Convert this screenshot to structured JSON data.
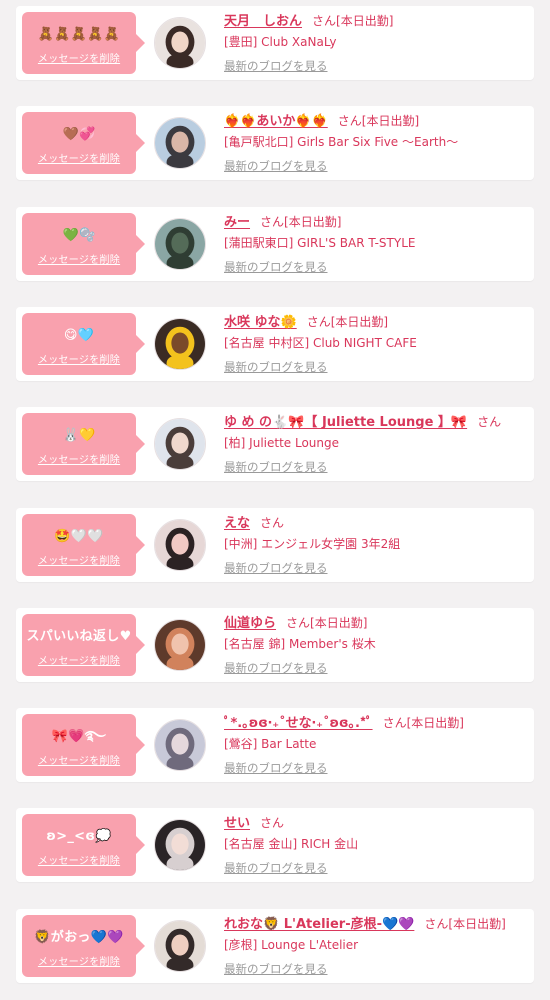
{
  "theme": {
    "bubble": "#f9a1ae",
    "accent": "#d9375b",
    "muted": "#9a9a9a",
    "background": "#f3f1f2"
  },
  "items": [
    {
      "message": "🧸🧸🧸🧸🧸",
      "delete_label": "メッセージを削除",
      "name": "天月　しおん",
      "san": "さん",
      "attendance": "[本日出勤]",
      "shop": "[豊田] Club XaNaLy",
      "blog_link": "最新のブログを見る",
      "avatar_icon": "girl-photo-avatar",
      "avatar_colors": [
        "#e9e2df",
        "#3a2a26",
        "#f1d6c8"
      ]
    },
    {
      "message": "🤎💞",
      "delete_label": "メッセージを削除",
      "name": "❤️‍🔥❤️‍🔥あいか❤️‍🔥❤️‍🔥",
      "san": "さん",
      "attendance": "[本日出勤]",
      "shop": "[亀戸駅北口] Girls Bar Six Five 〜Earth〜",
      "blog_link": "最新のブログを見る",
      "avatar_icon": "girl-photo-avatar",
      "avatar_colors": [
        "#b9cde0",
        "#3b3a3f",
        "#d9b7a8"
      ]
    },
    {
      "message": "💚🫧",
      "delete_label": "メッセージを削除",
      "name": "みー",
      "san": "さん",
      "attendance": "[本日出勤]",
      "shop": "[蒲田駅東口] GIRL'S BAR T-STYLE",
      "blog_link": "最新のブログを見る",
      "avatar_icon": "girl-photo-avatar",
      "avatar_colors": [
        "#8aa6a4",
        "#2f3d33",
        "#546b58"
      ]
    },
    {
      "message": "😋🩵",
      "delete_label": "メッセージを削除",
      "name": "水咲 ゆな🌼",
      "san": "さん",
      "attendance": "[本日出勤]",
      "shop": "[名古屋 中村区] Club NIGHT CAFE",
      "blog_link": "最新のブログを見る",
      "avatar_icon": "girl-photo-avatar",
      "avatar_colors": [
        "#3a2b24",
        "#f3c21d",
        "#7a4a2a"
      ]
    },
    {
      "message": "🐰💛",
      "delete_label": "メッセージを削除",
      "name": "ゆ め の🐇🎀【 Juliette Lounge 】🎀",
      "san": "さん",
      "attendance": "",
      "shop": "[柏] Juliette Lounge",
      "blog_link": "最新のブログを見る",
      "avatar_icon": "girl-photo-avatar",
      "avatar_colors": [
        "#dfe4ec",
        "#4a3d3a",
        "#f0d8cd"
      ]
    },
    {
      "message": "🤩🤍🤍",
      "delete_label": "メッセージを削除",
      "name": "えな",
      "san": "さん",
      "attendance": "",
      "shop": "[中洲] エンジェル女学園 3年2組",
      "blog_link": "最新のブログを見る",
      "avatar_icon": "girl-photo-avatar",
      "avatar_colors": [
        "#e6d7d6",
        "#2b2223",
        "#f1c9c4"
      ]
    },
    {
      "message": "スパいいね返し♥",
      "delete_label": "メッセージを削除",
      "name": "仙道ゆら",
      "san": "さん",
      "attendance": "[本日出勤]",
      "shop": "[名古屋 錦] Member's 桜木",
      "blog_link": "最新のブログを見る",
      "avatar_icon": "girl-photo-avatar",
      "avatar_colors": [
        "#5e3a2b",
        "#d1825c",
        "#f0c3ad"
      ]
    },
    {
      "message": "🎀💗࿐",
      "delete_label": "メッセージを削除",
      "name": "ﾟ*.｡ʚɞ‧₊˚せな‧₊˚ʚɞ｡.*ﾟ",
      "san": "さん",
      "attendance": "[本日出勤]",
      "shop": "[鶯谷] Bar Latte",
      "blog_link": "最新のブログを見る",
      "avatar_icon": "girl-photo-avatar",
      "avatar_colors": [
        "#c8c9d8",
        "#6f6a7c",
        "#e5d8dc"
      ]
    },
    {
      "message": "ʚ>_<ɞ💭",
      "delete_label": "メッセージを削除",
      "name": "せい",
      "san": "さん",
      "attendance": "",
      "shop": "[名古屋 金山] RICH 金山",
      "blog_link": "最新のブログを見る",
      "avatar_icon": "girl-photo-avatar",
      "avatar_colors": [
        "#2a2426",
        "#d7cfd0",
        "#f2ddd6"
      ]
    },
    {
      "message": "🦁がおっ💙💜",
      "delete_label": "メッセージを削除",
      "name": "れおな🦁 L'Atelier-彦根-💙💜",
      "san": "さん",
      "attendance": "[本日出勤]",
      "shop": "[彦根] Lounge L'Atelier",
      "blog_link": "最新のブログを見る",
      "avatar_icon": "girl-photo-avatar",
      "avatar_colors": [
        "#e4dcd6",
        "#332a29",
        "#efcfc1"
      ]
    }
  ]
}
